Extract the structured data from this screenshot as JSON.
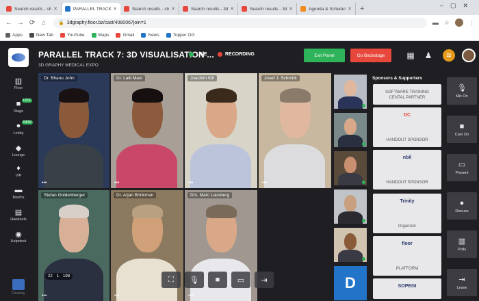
{
  "browser": {
    "tabs": [
      {
        "label": "Search results - shbc...",
        "active": false,
        "color": "#e8473b"
      },
      {
        "label": "PARALLEL TRACK",
        "active": true,
        "color": "#2274c9"
      },
      {
        "label": "Search results - shba...",
        "active": false,
        "color": "#e8473b"
      },
      {
        "label": "Search results - 3dgr...",
        "active": false,
        "color": "#e8473b"
      },
      {
        "label": "Search results - 3dgr...",
        "active": false,
        "color": "#e8473b"
      },
      {
        "label": "Agenda & Schedule",
        "active": false,
        "color": "#f08c1c"
      }
    ],
    "new_tab": "+",
    "url": "3dgraphy.floor.bz/cast/4080067join=1",
    "bookmarks": [
      {
        "label": "Apps",
        "color": "#5f6368"
      },
      {
        "label": "New Tab",
        "color": "#4a4a4a"
      },
      {
        "label": "YouTube",
        "color": "#e8473b"
      },
      {
        "label": "Maps",
        "color": "#2fb35a"
      },
      {
        "label": "Gmail",
        "color": "#e8473b"
      },
      {
        "label": "News",
        "color": "#2274c9"
      },
      {
        "label": "Topper OG",
        "color": "#2274c9"
      }
    ]
  },
  "header": {
    "title": "PARALLEL TRACK 7: 3D VISUALISATION ...",
    "subtitle": "3D GRAPHY MEDICAL EXPO",
    "live": "LIVE",
    "recording": "RECORDING",
    "exit_panel": "Exit Panel",
    "go_backstage": "Go Backstage",
    "live_color": "#2fb35a",
    "recording_color": "#e8473b"
  },
  "leftnav": [
    {
      "label": "Floor",
      "icon": "map-icon",
      "glyph": "▥"
    },
    {
      "label": "Stage",
      "icon": "stage-icon",
      "glyph": "■",
      "badge": "LIVE"
    },
    {
      "label": "Lobby",
      "icon": "lobby-icon",
      "glyph": "●",
      "badge": "NEW"
    },
    {
      "label": "Lounge",
      "icon": "lounge-icon",
      "glyph": "◆"
    },
    {
      "label": "VIP",
      "icon": "vip-icon",
      "glyph": "♦"
    },
    {
      "label": "Booths",
      "icon": "booth-icon",
      "glyph": "▬"
    },
    {
      "label": "Handouts",
      "icon": "handout-icon",
      "glyph": "▤"
    },
    {
      "label": "Helpdesk",
      "icon": "helpdesk-icon",
      "glyph": "◉"
    }
  ],
  "floor_label": "Floorlay",
  "tiles": [
    {
      "name": "Dr. Bhanu John",
      "bg": "#2c3a5a",
      "skin": "#8a5a3a",
      "shirt": "#3a4048",
      "hair": "#1a1212"
    },
    {
      "name": "Dr. Lalit Mani",
      "bg": "#a8a096",
      "skin": "#8c5a3c",
      "shirt": "#c9486a",
      "hair": "#161010"
    },
    {
      "name": "Joachim Kill",
      "bg": "#d8d4c8",
      "skin": "#d8a888",
      "shirt": "#bcc4dc",
      "hair": "#3a2a1c"
    },
    {
      "name": "Josef J. Schmidt",
      "bg": "#c8b8a0",
      "skin": "#e0b8a0",
      "shirt": "#dcdcde",
      "hair": "#8a7a6a"
    },
    {
      "name": "Stefan Goldenberger",
      "bg": "#4a6a60",
      "skin": "#d8b098",
      "shirt": "#2a3040",
      "hair": "#d8d0c8"
    },
    {
      "name": "Dr. Arjan Brinkman",
      "bg": "#8c7a60",
      "skin": "#d0a078",
      "shirt": "#e8e0d0",
      "hair": "#b8a080"
    },
    {
      "name": "Drs. Marc Lausberg",
      "bg": "#a09890",
      "skin": "#d8a888",
      "shirt": "#e8e8ec",
      "hair": "#7a6a5a"
    }
  ],
  "stats": {
    "viewers": "22",
    "speakers": "1",
    "attendees": "198"
  },
  "thumbs": [
    {
      "bg": "#b8bcc4",
      "skin": "#e0b8a0",
      "shirt": "#2a3458"
    },
    {
      "bg": "#7a8a8a",
      "skin": "#d8a888",
      "shirt": "#2a3040"
    },
    {
      "bg": "#5a4a3a",
      "skin": "#c89070",
      "shirt": "#3a3a44"
    },
    {
      "bg": "#c0c4c8",
      "skin": "#c8a080",
      "shirt": "#2a2a30"
    },
    {
      "bg": "#d0c4b0",
      "skin": "#8a5a3a",
      "shirt": "#3a3a44"
    }
  ],
  "d_avatar": "D",
  "sponsors": {
    "title": "Sponsors & Supporters",
    "cards": [
      {
        "label": "SOFTWARE TRAINING\nCENTAL PARTNER",
        "logo": ""
      },
      {
        "label": "HANDOUT SPONSOR",
        "logo": "DC"
      },
      {
        "label": "HANDOUT SPONSOR",
        "logo": "nbil"
      },
      {
        "label": "Organizer",
        "logo": "Trinity"
      },
      {
        "label": "PLATFORM",
        "logo": "floor"
      },
      {
        "label": "",
        "logo": "SOPEGI"
      }
    ]
  },
  "right_controls": [
    {
      "label": "Mic On",
      "icon": "mic-icon",
      "glyph": "🎙"
    },
    {
      "label": "Cam On",
      "icon": "camera-icon",
      "glyph": "■"
    },
    {
      "label": "Present",
      "icon": "present-icon",
      "glyph": "▭"
    },
    {
      "label": "Discuss",
      "icon": "discuss-icon",
      "glyph": "●"
    },
    {
      "label": "Polls",
      "icon": "polls-icon",
      "glyph": "▥"
    },
    {
      "label": "Leave",
      "icon": "leave-icon",
      "glyph": "⇥"
    }
  ]
}
